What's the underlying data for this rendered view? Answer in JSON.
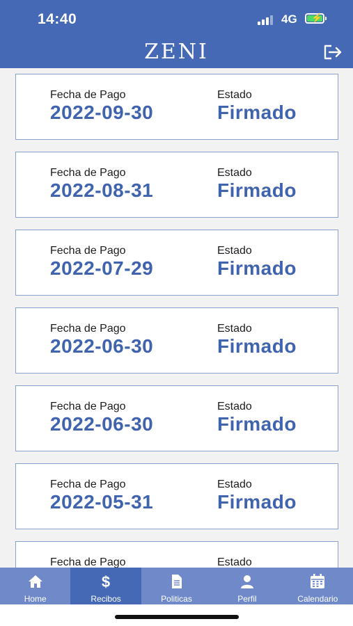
{
  "status_bar": {
    "time": "14:40",
    "network": "4G"
  },
  "header": {
    "logo": "ZENI",
    "logout_icon": "logout-icon"
  },
  "receipts": [
    {
      "date_label": "Fecha de Pago",
      "date": "2022-09-30",
      "status_label": "Estado",
      "status": "Firmado"
    },
    {
      "date_label": "Fecha de Pago",
      "date": "2022-08-31",
      "status_label": "Estado",
      "status": "Firmado"
    },
    {
      "date_label": "Fecha de Pago",
      "date": "2022-07-29",
      "status_label": "Estado",
      "status": "Firmado"
    },
    {
      "date_label": "Fecha de Pago",
      "date": "2022-06-30",
      "status_label": "Estado",
      "status": "Firmado"
    },
    {
      "date_label": "Fecha de Pago",
      "date": "2022-06-30",
      "status_label": "Estado",
      "status": "Firmado"
    },
    {
      "date_label": "Fecha de Pago",
      "date": "2022-05-31",
      "status_label": "Estado",
      "status": "Firmado"
    },
    {
      "date_label": "Fecha de Pago",
      "date": "",
      "status_label": "Estado",
      "status": ""
    }
  ],
  "tabs": [
    {
      "label": "Home",
      "icon": "home-icon",
      "active": false
    },
    {
      "label": "Recibos",
      "icon": "dollar-icon",
      "active": true
    },
    {
      "label": "Politicas",
      "icon": "document-icon",
      "active": false
    },
    {
      "label": "Perfil",
      "icon": "user-icon",
      "active": false
    },
    {
      "label": "Calendario",
      "icon": "calendar-icon",
      "active": false
    }
  ],
  "colors": {
    "header": "#4569b5",
    "tabbar": "#7089c9",
    "tab_active": "#4569b5",
    "value_text": "#3f63ad",
    "card_border": "#8aa0cf"
  }
}
